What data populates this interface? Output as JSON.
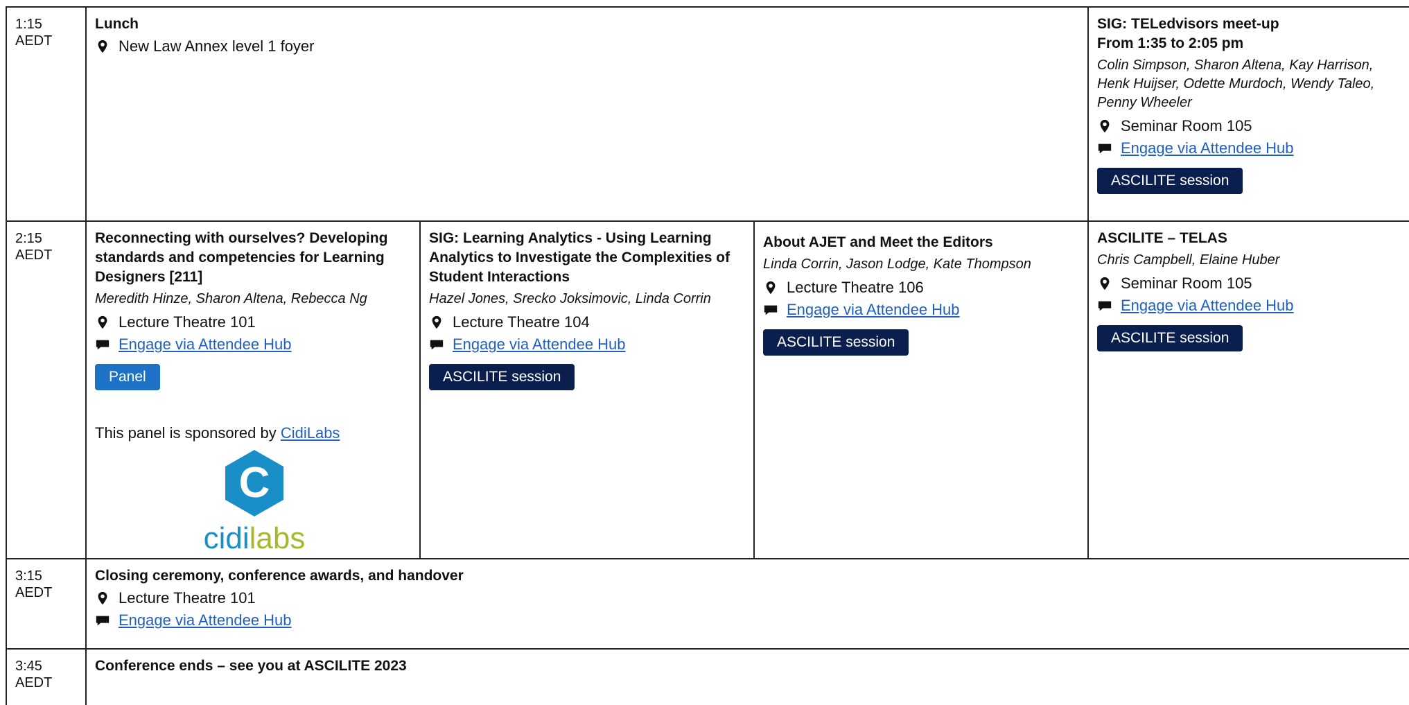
{
  "rows": [
    {
      "time": [
        "1:15",
        "AEDT"
      ],
      "lunch": {
        "title": "Lunch",
        "location": "New Law Annex level 1 foyer"
      },
      "sig_tel": {
        "title": "SIG: TELedvisors meet-up",
        "subtitle": "From 1:35 to 2:05 pm",
        "people": "Colin Simpson, Sharon Altena, Kay Harrison, Henk Huijser, Odette Murdoch, Wendy Taleo, Penny Wheeler",
        "location": "Seminar Room 105",
        "hub": "Engage via Attendee Hub",
        "tag": "ASCILITE session"
      }
    },
    {
      "time": [
        "2:15",
        "AEDT"
      ],
      "s1": {
        "title": "Reconnecting with ourselves? Developing standards and competencies for Learning Designers [211]",
        "people": "Meredith Hinze, Sharon Altena, Rebecca Ng",
        "location": "Lecture Theatre 101",
        "hub": "Engage via Attendee Hub",
        "tag": "Panel",
        "sponsor_text": "This panel is sponsored by ",
        "sponsor_link": "CidiLabs",
        "logo_letter": "C",
        "logo_word_a": "cidi",
        "logo_word_b": "labs"
      },
      "s2": {
        "title": "SIG: Learning Analytics - Using Learning Analytics to Investigate the Complexities of Student Interactions",
        "people": "Hazel Jones, Srecko Joksimovic, Linda Corrin",
        "location": "Lecture Theatre 104",
        "hub": "Engage via Attendee Hub",
        "tag": "ASCILITE session"
      },
      "s3": {
        "title": "About AJET and Meet the Editors",
        "people": "Linda Corrin, Jason Lodge, Kate Thompson",
        "location": "Lecture Theatre 106",
        "hub": "Engage via Attendee Hub",
        "tag": "ASCILITE session"
      },
      "s4": {
        "title": "ASCILITE – TELAS",
        "people": "Chris Campbell, Elaine Huber",
        "location": "Seminar Room 105",
        "hub": "Engage via Attendee Hub",
        "tag": "ASCILITE session"
      }
    },
    {
      "time": [
        "3:15",
        "AEDT"
      ],
      "closing": {
        "title": "Closing ceremony, conference awards, and handover",
        "location": "Lecture Theatre 101",
        "hub": "Engage via Attendee Hub"
      }
    },
    {
      "time": [
        "3:45",
        "AEDT"
      ],
      "end": {
        "title": "Conference ends – see you at ASCILITE 2023"
      }
    }
  ],
  "icons": {
    "location": "map-pin-icon",
    "hub": "speech-bubble-icon"
  },
  "colors": {
    "tag_dark": "#0b1f4e",
    "tag_panel": "#1d72c5",
    "link": "#1f5fbf",
    "logo_blue": "#1a8fc7",
    "logo_green": "#a6b92c"
  }
}
